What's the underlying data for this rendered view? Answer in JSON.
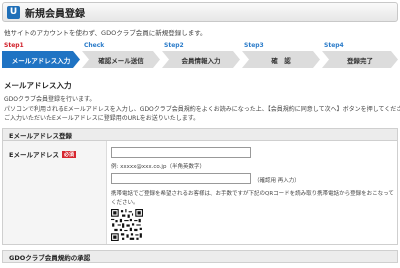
{
  "header": {
    "icon_letter": "U",
    "title": "新規会員登録"
  },
  "intro": "他サイトのアカウントを使わず、GDOクラブ会員に新規登録します。",
  "steps": [
    {
      "tag": "Step1",
      "label": "メールアドレス入力",
      "active": true
    },
    {
      "tag": "Check",
      "label": "確認メール送信",
      "active": false
    },
    {
      "tag": "Step2",
      "label": "会員情報入力",
      "active": false
    },
    {
      "tag": "Step3",
      "label": "確　認",
      "active": false
    },
    {
      "tag": "Step4",
      "label": "登録完了",
      "active": false
    }
  ],
  "section_title": "メールアドレス入力",
  "description": [
    "GDOクラブ会員登録を行います。",
    "パソコンで利用されるEメールアドレスを入力し、GDOクラブ会員規約をよくお読みになった上、【会員規約に同意して次へ】ボタンを押してください。",
    "ご入力いただいたEメールアドレスに登録用のURLをお送りいたします。"
  ],
  "email_panel": {
    "title": "Eメールアドレス登録",
    "label": "Eメールアドレス",
    "required_badge": "必須",
    "email_value": "",
    "example": "例: xxxxx@xxx.co.jp（半角英数字）",
    "confirm_value": "",
    "confirm_hint": "（確認用 再入力）",
    "mobile_note": "携帯電話でご登録を希望されるお客様は、お手数ですが下記のQRコードを読み取り携帯電話から登録をおこなってください。"
  },
  "terms_panel": {
    "title": "GDOクラブ会員規約の承認"
  }
}
